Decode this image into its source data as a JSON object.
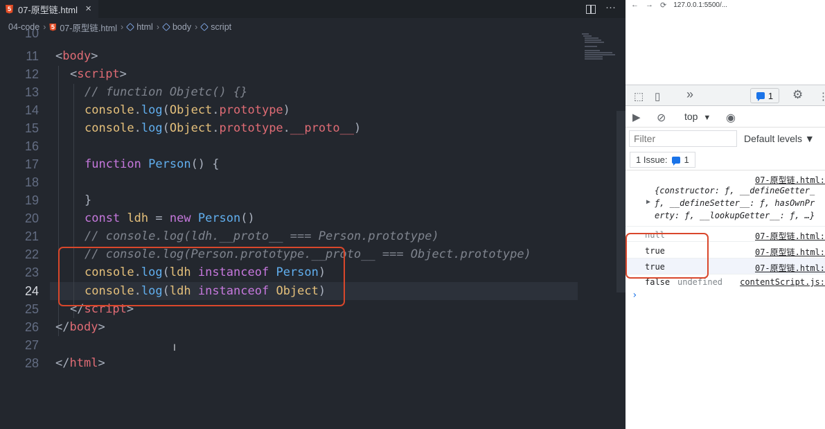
{
  "editor": {
    "tab_title": "07-原型链.html",
    "tab_icon": "html5-icon",
    "tab_close": "×",
    "actions": {
      "more": "···"
    },
    "breadcrumb": [
      "04-code",
      "07-原型链.html",
      "html",
      "body",
      "script"
    ],
    "line_numbers": [
      "10",
      "11",
      "12",
      "13",
      "14",
      "15",
      "16",
      "17",
      "18",
      "19",
      "20",
      "21",
      "22",
      "23",
      "24",
      "25",
      "26",
      "27",
      "28"
    ],
    "active_line": "24",
    "code": {
      "l11": [
        "<",
        "body",
        ">"
      ],
      "l12": [
        "<",
        "script",
        ">"
      ],
      "l13": "// function Objetc() {}",
      "l14": [
        "console",
        ".",
        "log",
        "(",
        "Object",
        ".",
        "prototype",
        ")"
      ],
      "l15": [
        "console",
        ".",
        "log",
        "(",
        "Object",
        ".",
        "prototype",
        ".",
        "__proto__",
        ")"
      ],
      "l17": [
        "function",
        " ",
        "Person",
        "() {"
      ],
      "l19": "}",
      "l20": [
        "const",
        " ",
        "ldh",
        " = ",
        "new",
        " ",
        "Person",
        "()"
      ],
      "l21": "// console.log(ldh.__proto__ === Person.prototype)",
      "l22": "// console.log(Person.prototype.__proto__ === Object.prototype)",
      "l23": [
        "console",
        ".",
        "log",
        "(",
        "ldh",
        " ",
        "instanceof",
        " ",
        "Person",
        ")"
      ],
      "l24": [
        "console",
        ".",
        "log",
        "(",
        "ldh",
        " ",
        "instanceof",
        " ",
        "Object",
        ")"
      ],
      "l25": [
        "</",
        "script",
        ">"
      ],
      "l26": [
        "</",
        "body",
        ">"
      ],
      "l28": [
        "</",
        "html",
        ">"
      ]
    },
    "text_cursor": "I"
  },
  "browser": {
    "nav": {
      "back": "←",
      "forward": "→",
      "reload": "⟳",
      "url": "127.0.0.1:5500/..."
    },
    "devtools": {
      "issues_count": "1",
      "context": "top",
      "filter_placeholder": "Filter",
      "levels": "Default levels ▼",
      "issue_label": "1 Issue:",
      "issue_count": "1"
    },
    "console": {
      "source": "07-原型链.html:",
      "obj_line1": "{constructor: ƒ, __defineGetter_",
      "obj_line2": "ƒ, __defineSetter__: ƒ, hasOwnPr",
      "obj_line3": "erty: ƒ, __lookupGetter__: ƒ, …}",
      "null_val": "null",
      "true1": "true",
      "true2": "true",
      "false_val": "false",
      "undefined_val": "undefined",
      "content_script": "contentScript.js:",
      "prompt": "›"
    }
  },
  "colors": {
    "highlight_box": "#d9472b",
    "editor_bg": "#23272e"
  }
}
